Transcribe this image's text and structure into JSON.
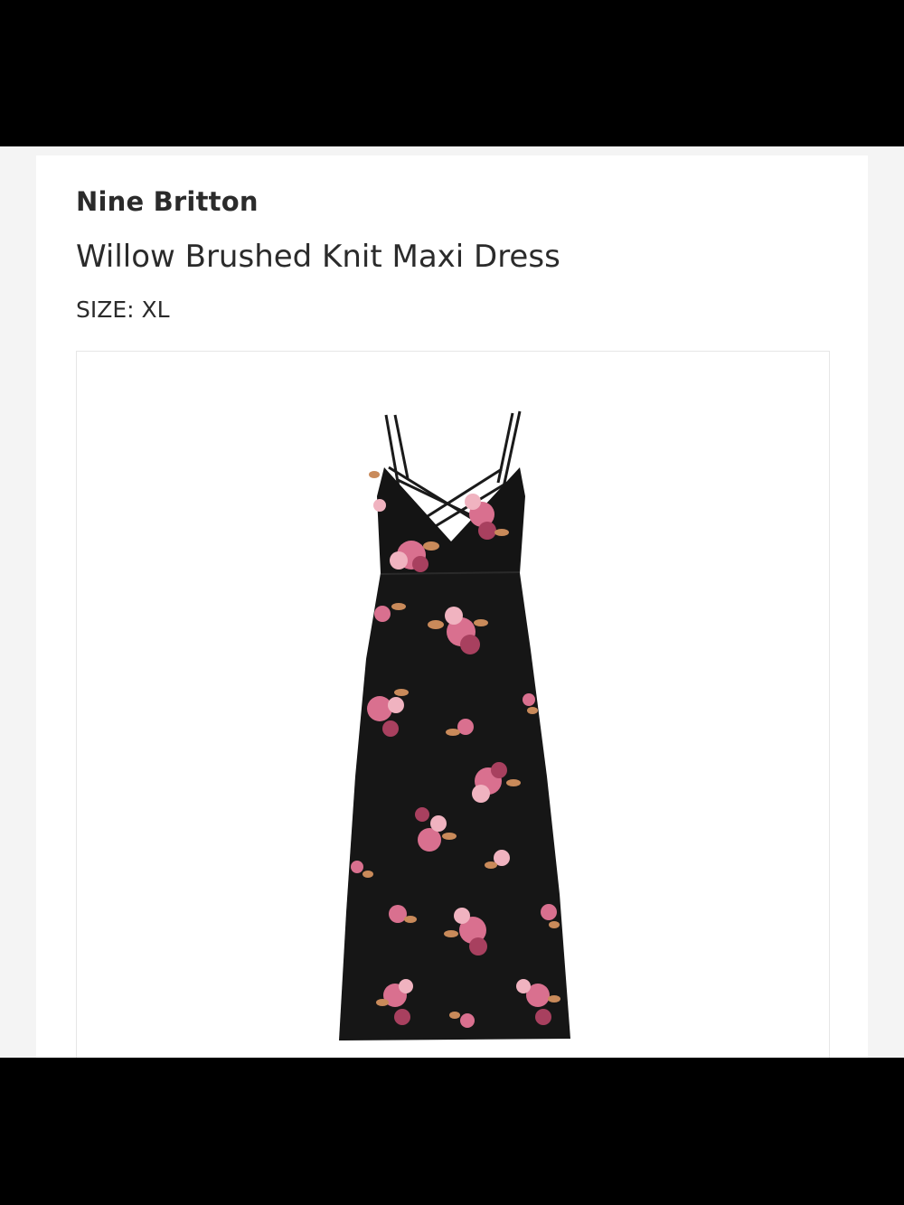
{
  "product": {
    "brand": "Nine Britton",
    "name": "Willow Brushed Knit Maxi Dress",
    "size_label": "SIZE:",
    "size_value": "XL"
  },
  "image": {
    "subject": "dress-photo",
    "colors": {
      "dress": "#141414",
      "strap": "#1a1a1a",
      "petal_pink": "#d9708f",
      "petal_light": "#f0b3c0",
      "petal_deep": "#a8405f",
      "leaf": "#c98a5a"
    }
  }
}
